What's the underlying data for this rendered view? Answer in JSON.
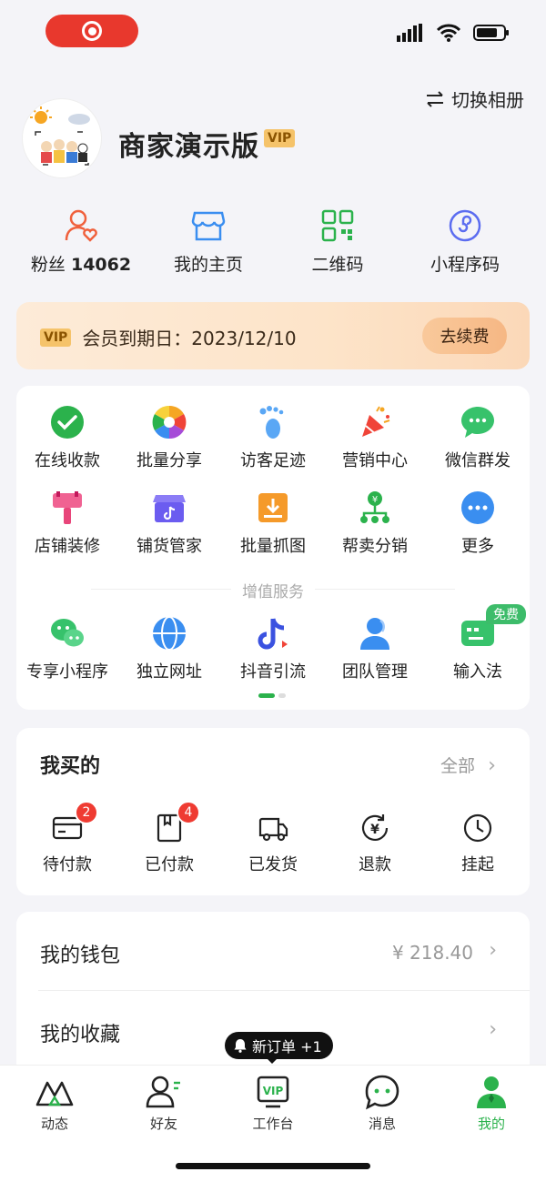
{
  "header": {
    "switch_album": "切换相册",
    "shop_name": "商家演示版",
    "vip_label": "VIP"
  },
  "quick_links": [
    {
      "label": "粉丝",
      "value": "14062",
      "icon": "user-heart-icon"
    },
    {
      "label": "我的主页",
      "icon": "storefront-icon"
    },
    {
      "label": "二维码",
      "icon": "qr-code-icon"
    },
    {
      "label": "小程序码",
      "icon": "mini-program-icon"
    }
  ],
  "vip_banner": {
    "badge": "VIP",
    "text": "会员到期日：2023/12/10",
    "button": "去续费"
  },
  "tools": [
    {
      "label": "在线收款",
      "icon": "wechat-pay-icon",
      "color": "#2bb24c"
    },
    {
      "label": "批量分享",
      "icon": "aperture-icon",
      "color": "#f5a623"
    },
    {
      "label": "访客足迹",
      "icon": "footprint-icon",
      "color": "#3a8ef0"
    },
    {
      "label": "营销中心",
      "icon": "party-popper-icon",
      "color": "#f04438"
    },
    {
      "label": "微信群发",
      "icon": "chat-bubble-icon",
      "color": "#37c26b"
    },
    {
      "label": "店铺装修",
      "icon": "paint-roller-icon",
      "color": "#e8457a"
    },
    {
      "label": "铺货管家",
      "icon": "douyin-store-icon",
      "color": "#6b5cf0"
    },
    {
      "label": "批量抓图",
      "icon": "download-box-icon",
      "color": "#f59a2a"
    },
    {
      "label": "帮卖分销",
      "icon": "distribution-icon",
      "color": "#2bb24c"
    },
    {
      "label": "更多",
      "icon": "more-dots-icon",
      "color": "#3a8ef0"
    }
  ],
  "value_added_title": "增值服务",
  "services": [
    {
      "label": "专享小程序",
      "icon": "mini-program-chat-icon",
      "color": "#37c26b"
    },
    {
      "label": "独立网址",
      "icon": "globe-icon",
      "color": "#3a8ef0"
    },
    {
      "label": "抖音引流",
      "icon": "douyin-icon",
      "color": "#3b52e0"
    },
    {
      "label": "团队管理",
      "icon": "team-user-icon",
      "color": "#3a8ef0"
    },
    {
      "label": "输入法",
      "icon": "keyboard-chat-icon",
      "color": "#37c26b"
    }
  ],
  "free_badge": "免费",
  "orders": {
    "title": "我买的",
    "all_label": "全部",
    "items": [
      {
        "label": "待付款",
        "icon": "card-icon",
        "badge": "2"
      },
      {
        "label": "已付款",
        "icon": "receipt-icon",
        "badge": "4"
      },
      {
        "label": "已发货",
        "icon": "truck-icon",
        "badge": ""
      },
      {
        "label": "退款",
        "icon": "refund-icon",
        "badge": ""
      },
      {
        "label": "挂起",
        "icon": "clock-icon",
        "badge": ""
      }
    ]
  },
  "wallet": {
    "label": "我的钱包",
    "value": "¥ 218.40"
  },
  "favorites": {
    "label": "我的收藏"
  },
  "toast": "新订单 +1",
  "tabbar": [
    {
      "label": "动态",
      "icon": "mountain-icon",
      "active": false
    },
    {
      "label": "好友",
      "icon": "friends-icon",
      "active": false
    },
    {
      "label": "工作台",
      "icon": "vip-workbench-icon",
      "active": false
    },
    {
      "label": "消息",
      "icon": "message-icon",
      "active": false
    },
    {
      "label": "我的",
      "icon": "profile-icon",
      "active": true
    }
  ],
  "colors": {
    "accent": "#2bb24c",
    "vip_gold": "#f5c36a",
    "badge_red": "#ef3b32"
  }
}
